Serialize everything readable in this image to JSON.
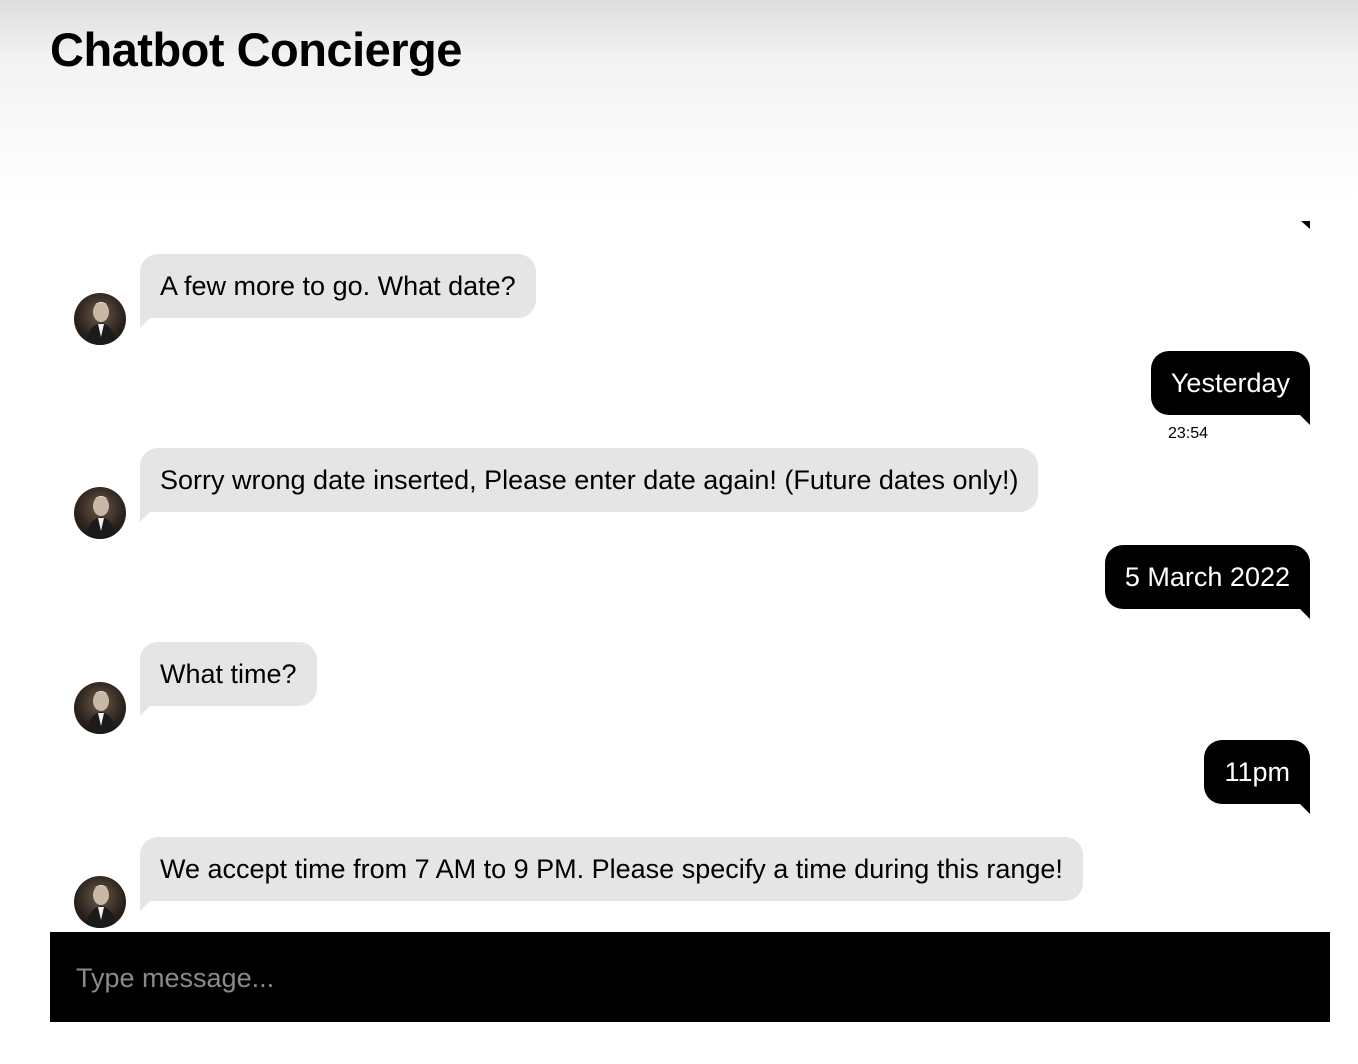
{
  "header": {
    "title": "Chatbot Concierge"
  },
  "messages": [
    {
      "sender": "bot",
      "text": "A few more to go. What date?"
    },
    {
      "sender": "user",
      "text": "Yesterday",
      "time": "23:54"
    },
    {
      "sender": "bot",
      "text": "Sorry wrong date inserted, Please enter date again! (Future dates only!)"
    },
    {
      "sender": "user",
      "text": "5 March 2022"
    },
    {
      "sender": "bot",
      "text": "What time?"
    },
    {
      "sender": "user",
      "text": "11pm"
    },
    {
      "sender": "bot",
      "text": "We accept time from 7 AM to 9 PM. Please specify a time during this range!"
    }
  ],
  "composer": {
    "placeholder": "Type message..."
  },
  "colors": {
    "bot_bubble": "#e5e5e5",
    "user_bubble": "#000000",
    "composer_bg": "#000000"
  },
  "icons": {
    "bot_avatar": "bot-avatar-photo"
  }
}
